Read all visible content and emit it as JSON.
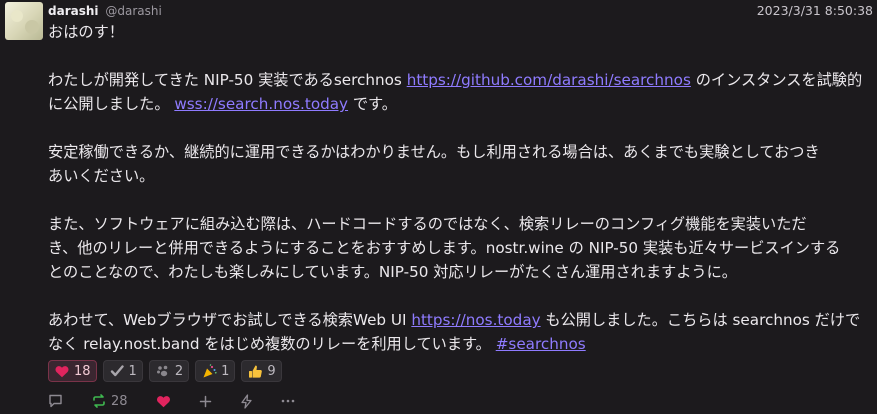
{
  "author": {
    "display_name": "darashi",
    "username": "@darashi"
  },
  "timestamp": "2023/3/31 8:50:38",
  "content": {
    "line1": "おはのす！",
    "p2_prefix": "わたしが開発してきた NIP-50 実装であるserchnos ",
    "p2_link1": "https://github.com/darashi/searchnos",
    "p2_middle": " のインスタンスを試験的",
    "p2_line2_prefix": "に公開しました。 ",
    "p2_link2": "wss://search.nos.today",
    "p2_suffix": " です。",
    "p3_line1": "安定稼働できるか、継続的に運用できるかはわかりません。もし利用される場合は、あくまでも実験としておつき",
    "p3_line2": "あいください。",
    "p4_line1": "また、ソフトウェアに組み込む際は、ハードコードするのではなく、検索リレーのコンフィグ機能を実装いただ",
    "p4_line2": "き、他のリレーと併用できるようにすることをおすすめします。nostr.wine の NIP-50 実装も近々サービスインする",
    "p4_line3": "とのことなので、わたしも楽しみにしています。NIP-50 対応リレーがたくさん運用されますように。",
    "p5_prefix": "あわせて、Webブラウザでお試しできる検索Web UI ",
    "p5_link": "https://nos.today",
    "p5_suffix": " も公開しました。こちらは searchnos だけで",
    "p5_line2": "なく relay.nost.band をはじめ複数のリレーを利用しています。 ",
    "p5_hashtag": "#searchnos"
  },
  "reactions": [
    {
      "icon": "heart-icon",
      "count": "18",
      "active": true
    },
    {
      "icon": "check-icon",
      "count": "1"
    },
    {
      "icon": "paw-icon",
      "count": "2"
    },
    {
      "icon": "party-popper-icon",
      "count": "1"
    },
    {
      "icon": "thumbs-up-icon",
      "count": "9"
    }
  ],
  "actions": {
    "reply": {
      "icon": "reply-icon"
    },
    "repost": {
      "icon": "repost-icon",
      "count": "28"
    },
    "like": {
      "icon": "heart-icon"
    },
    "add": {
      "icon": "plus-icon"
    },
    "zap": {
      "icon": "zap-icon"
    },
    "more": {
      "icon": "more-icon"
    }
  },
  "colors": {
    "background": "#1c1a1d",
    "text": "#ebe8ec",
    "link": "#8f7bff",
    "accent_heart": "#e0245e",
    "repost_green": "#3fb950"
  }
}
